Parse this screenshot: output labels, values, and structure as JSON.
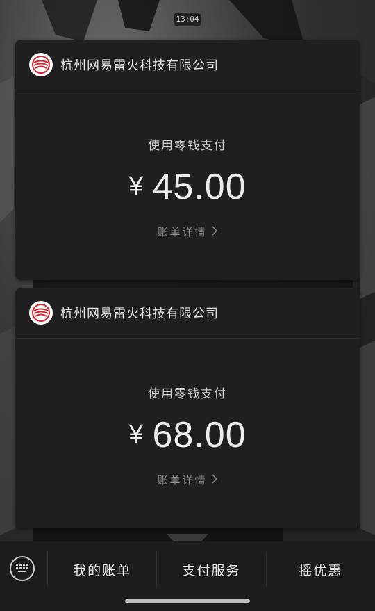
{
  "status": {
    "time": "13:04"
  },
  "cards": [
    {
      "merchant_name": "杭州网易雷火科技有限公司",
      "pay_method": "使用零钱支付",
      "currency": "¥",
      "amount": "45.00",
      "detail_link": "账单详情",
      "logo_icon": "netease-logo-icon"
    },
    {
      "merchant_name": "杭州网易雷火科技有限公司",
      "pay_method": "使用零钱支付",
      "currency": "¥",
      "amount": "68.00",
      "detail_link": "账单详情",
      "logo_icon": "netease-logo-icon"
    }
  ],
  "bottom_menu": {
    "keyboard_icon": "keyboard-icon",
    "items": [
      {
        "label": "我的账单"
      },
      {
        "label": "支付服务"
      },
      {
        "label": "摇优惠"
      }
    ]
  },
  "colors": {
    "card_bg": "#1f1f1f",
    "bar_bg": "#1c1c1c",
    "logo_red": "#d8262e",
    "text_primary": "#ededed",
    "text_muted": "#8c8c8c"
  }
}
